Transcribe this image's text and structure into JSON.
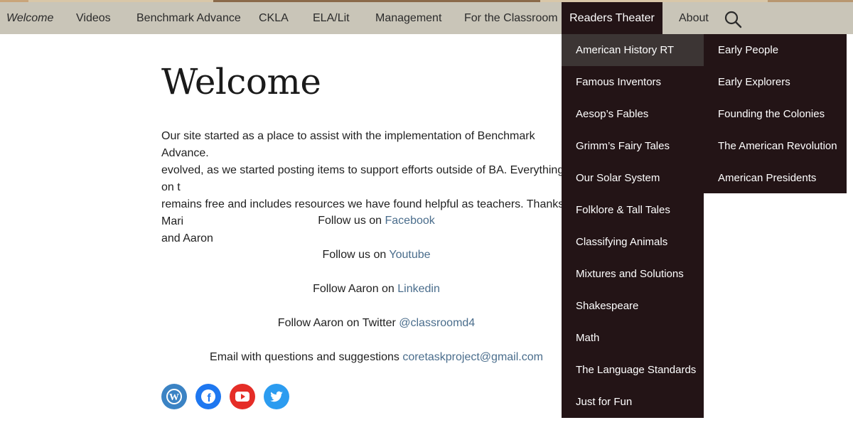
{
  "nav": {
    "items": [
      {
        "label": "Welcome"
      },
      {
        "label": "Videos"
      },
      {
        "label": "Benchmark Advance"
      },
      {
        "label": "CKLA"
      },
      {
        "label": "ELA/Lit"
      },
      {
        "label": "Management"
      },
      {
        "label": "For the Classroom"
      },
      {
        "label": "Readers Theater"
      },
      {
        "label": "About"
      }
    ],
    "search_icon": "search-icon"
  },
  "dropdown": {
    "items": [
      {
        "label": "American History RT"
      },
      {
        "label": "Famous Inventors"
      },
      {
        "label": "Aesop’s Fables"
      },
      {
        "label": "Grimm’s Fairy Tales"
      },
      {
        "label": "Our Solar System"
      },
      {
        "label": "Folklore & Tall Tales"
      },
      {
        "label": "Classifying Animals"
      },
      {
        "label": "Mixtures and Solutions"
      },
      {
        "label": "Shakespeare"
      },
      {
        "label": "Math"
      },
      {
        "label": "The Language Standards"
      },
      {
        "label": "Just for Fun"
      }
    ],
    "submenu": [
      {
        "label": "Early People"
      },
      {
        "label": "Early Explorers"
      },
      {
        "label": "Founding the Colonies"
      },
      {
        "label": "The American Revolution"
      },
      {
        "label": "American Presidents"
      }
    ]
  },
  "main": {
    "title": "Welcome",
    "intro_lines": [
      "Our site started as a place to assist with the implementation of Benchmark Advance.",
      "evolved, as we started posting items to support efforts outside of BA. Everything on t",
      "remains free and includes resources we have found helpful as teachers. Thanks! Mari",
      "and Aaron"
    ],
    "follow": [
      {
        "text": "Follow us on ",
        "link": "Facebook"
      },
      {
        "text": "Follow us on ",
        "link": "Youtube"
      },
      {
        "text": "Follow Aaron on ",
        "link": "Linkedin"
      },
      {
        "text": "Follow Aaron on Twitter ",
        "link": "@classroomd4"
      },
      {
        "text": "Email with questions and suggestions ",
        "link": "coretaskproject@gmail.com"
      }
    ]
  },
  "social": [
    {
      "icon": "wordpress-icon",
      "color": "#3b83c4"
    },
    {
      "icon": "facebook-icon",
      "color": "#1e77f0"
    },
    {
      "icon": "youtube-icon",
      "color": "#e52d27"
    },
    {
      "icon": "twitter-icon",
      "color": "#2c9cf0"
    }
  ],
  "colors": {
    "nav_bg": "#c9c5b8",
    "dropdown_bg": "#231416",
    "dropdown_hover": "#3c3534",
    "link": "#4a6d8c"
  }
}
